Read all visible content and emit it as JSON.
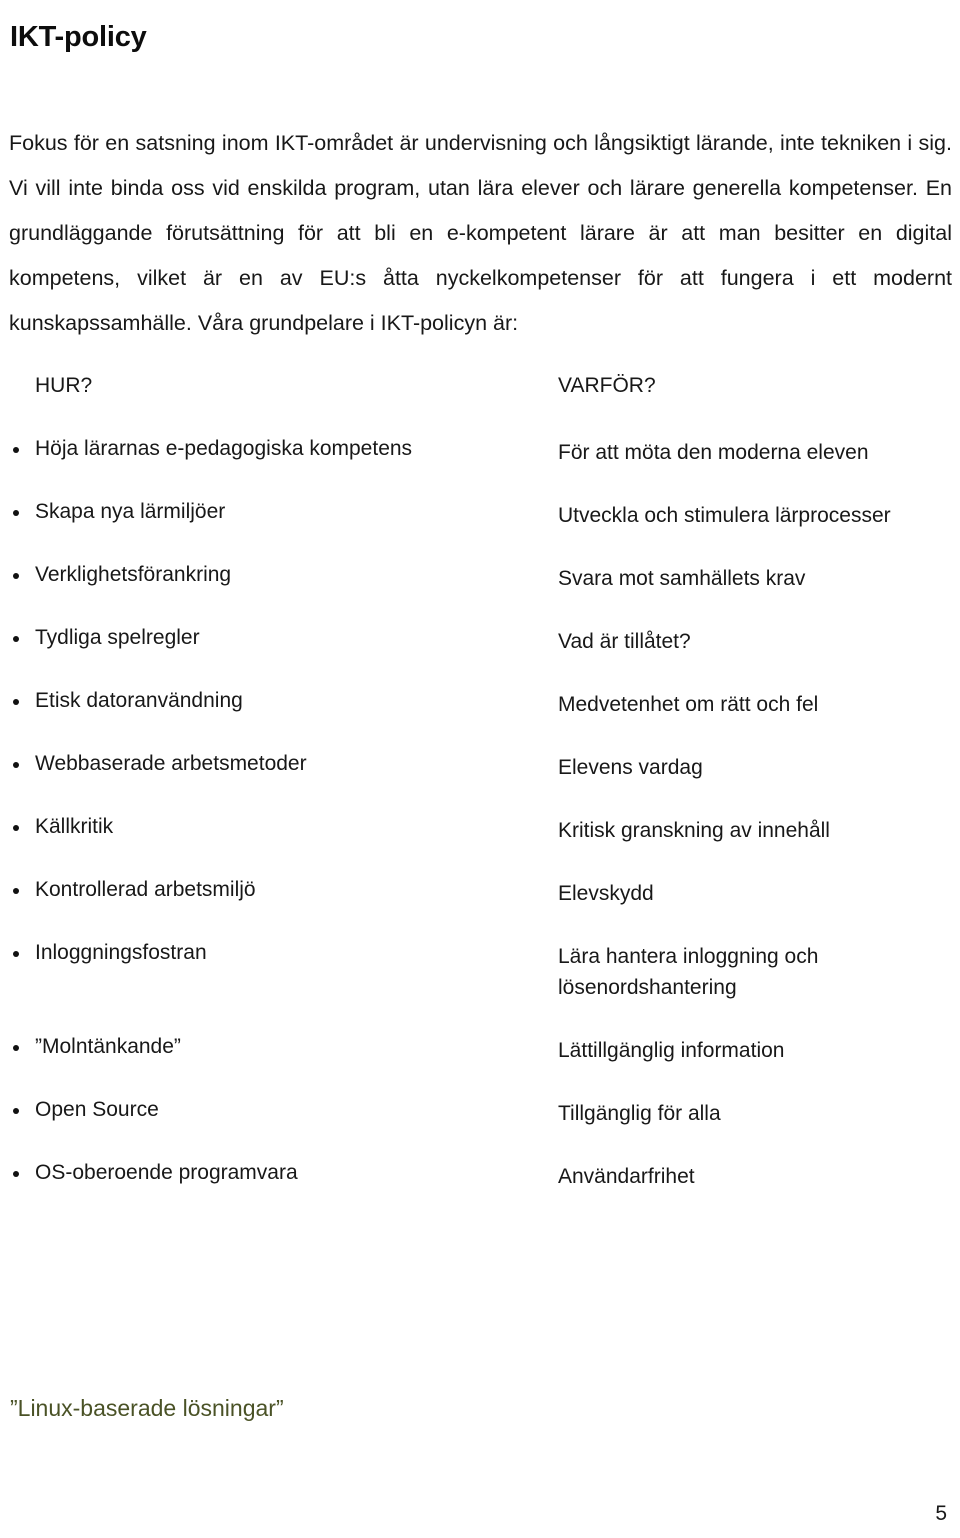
{
  "document": {
    "title": "IKT-policy",
    "page_number": "5",
    "accent_color": "#4a5226",
    "text_color": "#181818"
  },
  "intro_paragraph": "Fokus för en satsning inom IKT-området är undervisning och långsiktigt lärande, inte tekniken i sig. Vi vill inte binda oss vid enskilda program, utan lära elever och lärare generella kompetenser. En grundläggande förutsättning för att bli en e-kompetent lärare är att man besitter en digital kompetens, vilket är en av EU:s åtta nyckelkompetenser för att fungera i ett modernt kunskapssamhälle. Våra grundpelare i IKT-policyn är:",
  "table": {
    "headers": {
      "how": "HUR?",
      "why": "VARFÖR?"
    },
    "rows": [
      {
        "how": "Höja lärarnas e-pedagogiska kompetens",
        "why": "För att möta den moderna eleven"
      },
      {
        "how": "Skapa nya lärmiljöer",
        "why": "Utveckla och stimulera lärprocesser"
      },
      {
        "how": "Verklighetsförankring",
        "why": "Svara mot samhällets krav"
      },
      {
        "how": "Tydliga spelregler",
        "why": "Vad är tillåtet?"
      },
      {
        "how": "Etisk datoranvändning",
        "why": "Medvetenhet om rätt och fel"
      },
      {
        "how": "Webbaserade arbetsmetoder",
        "why": "Elevens vardag"
      },
      {
        "how": "Källkritik",
        "why": "Kritisk granskning av innehåll"
      },
      {
        "how": "Kontrollerad arbetsmiljö",
        "why": "Elevskydd"
      },
      {
        "how": "Inloggningsfostran",
        "why": "Lära hantera inloggning och\n lösenordshantering"
      },
      {
        "how": "”Molntänkande”",
        "why": "Lättillgänglig information"
      },
      {
        "how": "Open Source",
        "why": "Tillgänglig för alla"
      },
      {
        "how": "OS-oberoende programvara",
        "why": "Användarfrihet"
      }
    ]
  },
  "footer_note": "”Linux-baserade lösningar”"
}
